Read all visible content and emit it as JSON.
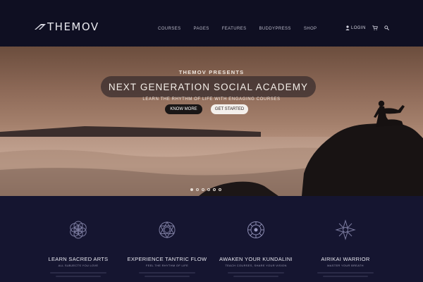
{
  "brand": {
    "logo_text": "THEMOV"
  },
  "nav": {
    "items": [
      "COURSES",
      "PAGES",
      "FEATURES",
      "BUDDYPRESS",
      "SHOP"
    ],
    "login_label": "LOGIN",
    "icons": [
      "user-icon",
      "cart-icon",
      "search-icon"
    ]
  },
  "hero": {
    "kicker": "THEMOV PRESENTS",
    "title": "NEXT GENERATION SOCIAL ACADEMY",
    "subtitle": "LEARN THE RHYTHM OF LIFE WITH ENGAGING COURSES",
    "primary_button": "KNOW MORE",
    "secondary_button": "GET STARTED",
    "slide_count": 6,
    "active_slide": 1
  },
  "features": [
    {
      "title": "LEARN SACRED ARTS",
      "subtitle": "ALL SUBJECTS YOU LOVE",
      "icon": "flower-of-life-icon"
    },
    {
      "title": "EXPERIENCE TANTRIC FLOW",
      "subtitle": "FEEL THE RHYTHM OF LIFE",
      "icon": "sacred-geometry-icon"
    },
    {
      "title": "AWAKEN YOUR KUNDALINI",
      "subtitle": "TEACH COURSES, SHARE YOUR VISION",
      "icon": "mandala-icon"
    },
    {
      "title": "AIRIKAI WARRIOR",
      "subtitle": "MASTER YOUR BREATH",
      "icon": "star-burst-icon"
    }
  ],
  "colors": {
    "header_bg": "#0f0f22",
    "features_bg": "#151530",
    "title_pill": "#3c3030"
  }
}
